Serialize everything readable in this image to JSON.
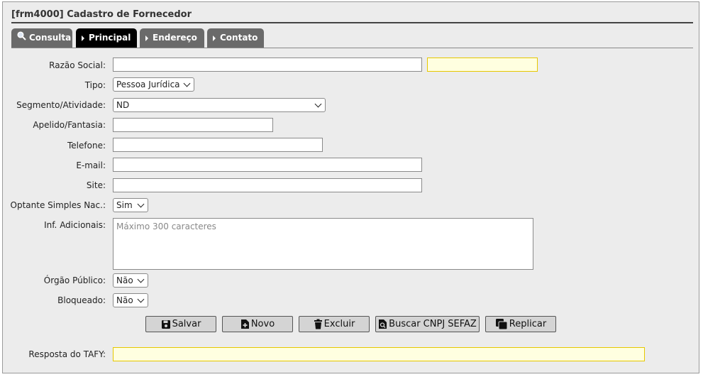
{
  "window": {
    "title": "[frm4000] Cadastro de Fornecedor"
  },
  "tabs": [
    {
      "label": "Consulta",
      "icon": "magnifier-icon"
    },
    {
      "label": "Principal",
      "icon": "triangle-right-icon"
    },
    {
      "label": "Endereço",
      "icon": "triangle-right-icon"
    },
    {
      "label": "Contato",
      "icon": "triangle-right-icon"
    }
  ],
  "form": {
    "razao_social": {
      "label": "Razão Social:",
      "value": "",
      "extra_value": ""
    },
    "tipo": {
      "label": "Tipo:",
      "selected": "Pessoa Jurídica"
    },
    "segmento": {
      "label": "Segmento/Atividade:",
      "selected": "ND"
    },
    "apelido": {
      "label": "Apelido/Fantasia:",
      "value": ""
    },
    "telefone": {
      "label": "Telefone:",
      "value": ""
    },
    "email": {
      "label": "E-mail:",
      "value": ""
    },
    "site": {
      "label": "Site:",
      "value": ""
    },
    "optante": {
      "label": "Optante Simples Nac.:",
      "selected": "Sim"
    },
    "inf_adicionais": {
      "label": "Inf. Adicionais:",
      "value": "",
      "placeholder": "Máximo 300 caracteres"
    },
    "orgao_publico": {
      "label": "Órgão Público:",
      "selected": "Não"
    },
    "bloqueado": {
      "label": "Bloqueado:",
      "selected": "Não"
    },
    "resposta_tafy": {
      "label": "Resposta do TAFY:",
      "value": ""
    }
  },
  "buttons": {
    "salvar": "Salvar",
    "novo": "Novo",
    "excluir": "Excluir",
    "buscar_cnpj": "Buscar CNPJ SEFAZ",
    "replicar": "Replicar"
  },
  "colors": {
    "active_tab": "#000000",
    "inactive_tab": "#6a6a6a",
    "highlight_field": "#ffffe0",
    "highlight_border": "#e6c800"
  }
}
